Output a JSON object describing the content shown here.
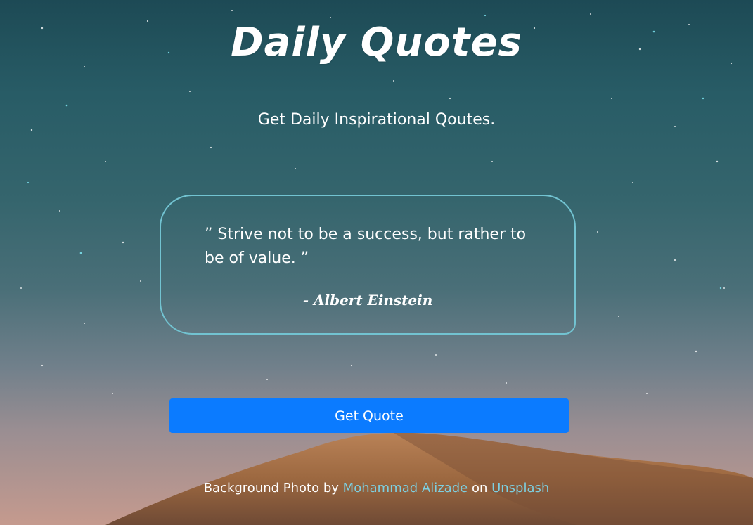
{
  "header": {
    "title": "Daily Quotes",
    "subtitle": "Get Daily Inspirational Qoutes."
  },
  "quote": {
    "text": "” Strive not to be a success, but rather to be of value. ”",
    "author": "- Albert Einstein"
  },
  "actions": {
    "get_quote_label": "Get Quote"
  },
  "credits": {
    "prefix": "Background Photo by",
    "photographer": "Mohammad Alizade",
    "middle": "on",
    "site": "Unsplash"
  },
  "colors": {
    "accent_button": "#0b7bff",
    "card_border": "#72c3d1",
    "link": "#7dcfe0",
    "sky_top": "#1d4a55",
    "horizon": "#c59a8e",
    "mountain": "#a8714a"
  }
}
